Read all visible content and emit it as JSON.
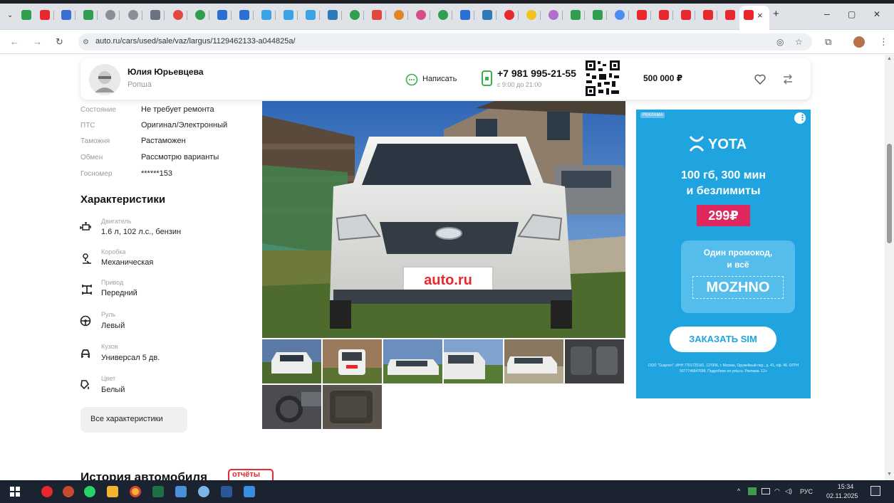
{
  "browser": {
    "url": "auto.ru/cars/used/sale/vaz/largus/1129462133-a044825a/",
    "active_tab_close": "×",
    "new_tab": "+",
    "minimize": "–",
    "restore": "▢",
    "close": "✕"
  },
  "seller": {
    "name": "Юлия Юрьевцева",
    "city": "Ропша",
    "write_label": "Написать",
    "phone": "+7 981 995-21-55",
    "hours": "с 9:00 до 21:00",
    "price": "500 000 ₽"
  },
  "properties": [
    {
      "label": "Состояние",
      "value": "Не требует ремонта"
    },
    {
      "label": "ПТС",
      "value": "Оригинал/Электронный"
    },
    {
      "label": "Таможня",
      "value": "Растаможен"
    },
    {
      "label": "Обмен",
      "value": "Рассмотрю варианты"
    },
    {
      "label": "Госномер",
      "value": "******153"
    }
  ],
  "specs_title": "Характеристики",
  "specs": [
    {
      "label": "Двигатель",
      "value": "1.6 л, 102 л.с., бензин",
      "icon": "engine-icon"
    },
    {
      "label": "Коробка",
      "value": "Механическая",
      "icon": "gearbox-icon"
    },
    {
      "label": "Привод",
      "value": "Передний",
      "icon": "drivetrain-icon"
    },
    {
      "label": "Руль",
      "value": "Левый",
      "icon": "steering-wheel-icon"
    },
    {
      "label": "Кузов",
      "value": "Универсал 5 дв.",
      "icon": "car-body-icon"
    },
    {
      "label": "Цвет",
      "value": "Белый",
      "icon": "color-icon"
    }
  ],
  "all_specs_label": "Все характеристики",
  "photo": {
    "watermark": "auto.ru",
    "thumb_count": 8
  },
  "ad": {
    "badge": "РЕКЛАМА",
    "brand": "YOTA",
    "line1": "100 гб, 300 мин",
    "line2": "и безлимиты",
    "price": "299₽",
    "promo_line1": "Один промокод,",
    "promo_line2": "и всё",
    "promo_code": "MOZHNO",
    "cta": "ЗАКАЗАТЬ SIM",
    "legal": "ООО \"Скартел\". ИНН 7701725181. 127006, г. Москва, Оружейный пер., д. 41, оф. 48. ОГРН 5077746847698. Подробнее на yota.ru. Реклама. 12+"
  },
  "history": {
    "title": "История автомобиля",
    "badge": "отчёты"
  },
  "taskbar": {
    "lang": "РУС",
    "time": "15:34",
    "date": "02.11.2025"
  }
}
